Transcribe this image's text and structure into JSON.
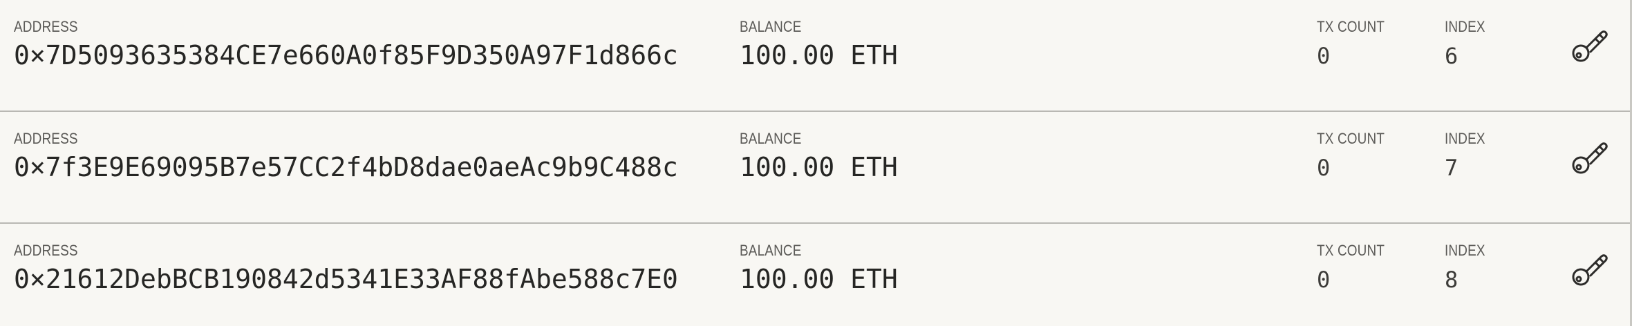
{
  "labels": {
    "address": "ADDRESS",
    "balance": "BALANCE",
    "tx_count": "TX COUNT",
    "index": "INDEX"
  },
  "accounts": [
    {
      "address": "0×7D5093635384CE7e660A0f85F9D350A97F1d866c",
      "balance": "100.00 ETH",
      "tx_count": "0",
      "index": "6",
      "action_icon": "key-icon"
    },
    {
      "address": "0×7f3E9E69095B7e57CC2f4bD8dae0aeAc9b9C488c",
      "balance": "100.00 ETH",
      "tx_count": "0",
      "index": "7",
      "action_icon": "key-icon"
    },
    {
      "address": "0×21612DebBCB190842d5341E33AF88fAbe588c7E0",
      "balance": "100.00 ETH",
      "tx_count": "0",
      "index": "8",
      "action_icon": "key-icon"
    }
  ],
  "colors": {
    "background": "#f8f7f3",
    "divider": "#b9b8b3",
    "label": "#5b5a57",
    "value": "#262624"
  }
}
